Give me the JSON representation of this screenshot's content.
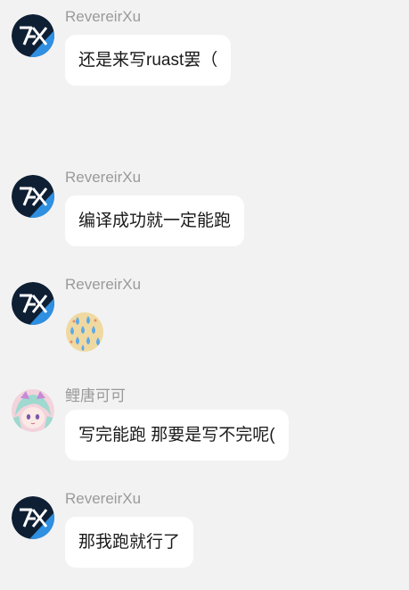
{
  "messages": [
    {
      "sender": "RevereirXu",
      "text": "还是来写ruast罢（"
    },
    {
      "sender": "RevereirXu",
      "text": "编译成功就一定能跑"
    },
    {
      "sender": "RevereirXu",
      "sticker": "tears-sticker"
    },
    {
      "sender": "鲤唐可可",
      "text": "写完能跑 那要是写不完呢("
    },
    {
      "sender": "RevereirXu",
      "text": "那我跑就行了"
    }
  ],
  "avatars": {
    "reverierxu": "dark-blue-logo-avatar",
    "litangkeke": "anime-girl-avatar"
  }
}
